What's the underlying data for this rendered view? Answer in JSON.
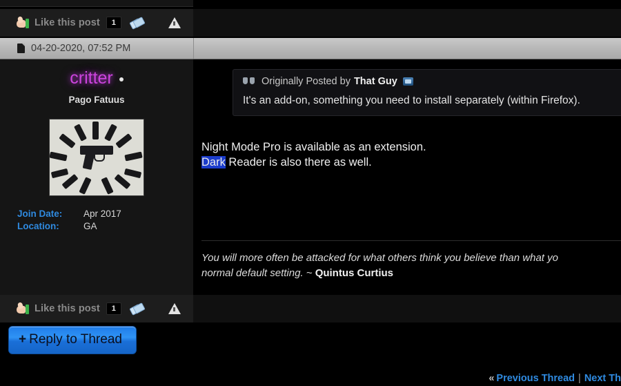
{
  "likebar": {
    "thumb_icon": "thumbs-up-icon",
    "label": "Like this post",
    "count": "1",
    "tag_icon": "tag-icon",
    "report_icon": "warning-triangle-icon"
  },
  "date_header": {
    "icon": "post-page-icon",
    "text": "04-20-2020, 07:52 PM"
  },
  "user": {
    "name": "critter",
    "online_indicator": "online-dot",
    "title": "Pago Fatuus",
    "avatar_alt": "pistol-and-magazines-avatar",
    "fields": [
      {
        "label": "Join Date:",
        "value": "Apr 2017"
      },
      {
        "label": "Location:",
        "value": "GA"
      }
    ]
  },
  "post": {
    "quote": {
      "icon": "quote-marks-icon",
      "prefix": "Originally Posted by",
      "author": "That Guy",
      "view_icon": "view-post-icon",
      "body": "It's an add-on, something you need to install separately (within Firefox)."
    },
    "message_line1": "Night Mode Pro is available as an extension.",
    "message_highlight": "Dark",
    "message_line2": " Reader is also there as well.",
    "signature_part1": "You will more often be attacked for what others think you believe than what yo",
    "signature_part2": "normal default setting. ~ ",
    "signature_author": "Quintus Curtius"
  },
  "reply": {
    "plus": "+",
    "label": "Reply to Thread"
  },
  "bottom_nav": {
    "chevron": "«",
    "previous": "Previous Thread",
    "separator": "|",
    "next": "Next Th"
  },
  "colors": {
    "username": "#cc44dd",
    "link": "#2f8ae0",
    "highlight": "#1b3ccb",
    "button": "#2f93f5"
  }
}
